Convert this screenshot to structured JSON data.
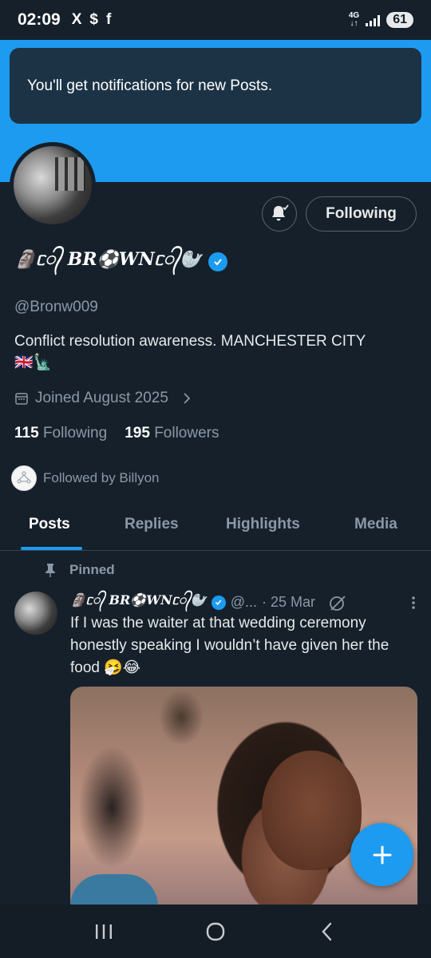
{
  "status": {
    "time": "02:09",
    "left_icons": [
      "X",
      "$",
      "f"
    ],
    "network_top": "4G",
    "network_bottom": "↓↑",
    "battery": "61"
  },
  "toast": {
    "message": "You'll get notifications for new Posts."
  },
  "profile": {
    "display_name": "🗿ᥴ᭄ 𝑩𝑹⚽𝑾𝑵ᥴ᭄🦭",
    "handle": "@Bronw009",
    "bio_line1": "Conflict resolution awareness. MANCHESTER CITY",
    "bio_line2": "🇬🇧🗽",
    "joined": "Joined August 2025",
    "following_count": "115",
    "following_label": "Following",
    "followers_count": "195",
    "followers_label": "Followers",
    "followed_by": "Followed by Billyon",
    "follow_button": "Following"
  },
  "tabs": [
    {
      "label": "Posts",
      "active": true
    },
    {
      "label": "Replies",
      "active": false
    },
    {
      "label": "Highlights",
      "active": false
    },
    {
      "label": "Media",
      "active": false
    }
  ],
  "post": {
    "pinned_label": "Pinned",
    "author_name": "🗿ᥴ᭄ 𝑩𝑹⚽𝑾𝑵ᥴ᭄🦭",
    "author_handle": "@...",
    "date": "· 25 Mar",
    "text": "If I was the waiter at that wedding ceremony honestly speaking I wouldn’t have given her the food 🤧😂"
  },
  "colors": {
    "background": "#15202b",
    "accent": "#1d9bf0",
    "secondary_text": "#8b98a5"
  },
  "icons": [
    "x-logo-icon",
    "dollar-icon",
    "facebook-icon",
    "signal-icon",
    "battery-icon",
    "bell-check-icon",
    "verified-badge-icon",
    "calendar-icon",
    "chevron-right-icon",
    "pin-icon",
    "grok-icon",
    "more-icon",
    "plus-icon",
    "recents-icon",
    "home-icon",
    "back-icon"
  ]
}
